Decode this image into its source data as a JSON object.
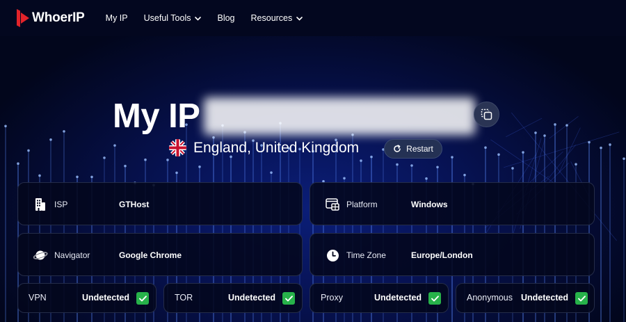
{
  "brand": {
    "name": "WhoerIP",
    "accent_color": "#e2232a"
  },
  "nav": {
    "items": [
      {
        "label": "My IP",
        "has_dropdown": false
      },
      {
        "label": "Useful Tools",
        "has_dropdown": true
      },
      {
        "label": "Blog",
        "has_dropdown": false
      },
      {
        "label": "Resources",
        "has_dropdown": true
      }
    ]
  },
  "hero": {
    "title": "My IP",
    "ip_address_visible": false,
    "copy_icon": "copy-icon",
    "location": "England, United Kingdom",
    "flag_icon": "uk-flag-icon",
    "restart_label": "Restart"
  },
  "info": {
    "isp": {
      "label": "ISP",
      "value": "GTHost",
      "icon": "building-icon"
    },
    "platform": {
      "label": "Platform",
      "value": "Windows",
      "icon": "windows-platform-icon"
    },
    "navigator": {
      "label": "Navigator",
      "value": "Google Chrome",
      "icon": "planet-icon"
    },
    "timezone": {
      "label": "Time Zone",
      "value": "Europe/London",
      "icon": "clock-icon"
    }
  },
  "checks": [
    {
      "label": "VPN",
      "value": "Undetected",
      "icon": "checkmark-icon"
    },
    {
      "label": "TOR",
      "value": "Undetected",
      "icon": "checkmark-icon"
    },
    {
      "label": "Proxy",
      "value": "Undetected",
      "icon": "checkmark-icon"
    },
    {
      "label": "Anonymous",
      "value": "Undetected",
      "icon": "checkmark-icon"
    }
  ],
  "colors": {
    "background": "#02061c",
    "card_border": "#242c48",
    "check_green": "#27b24a"
  }
}
